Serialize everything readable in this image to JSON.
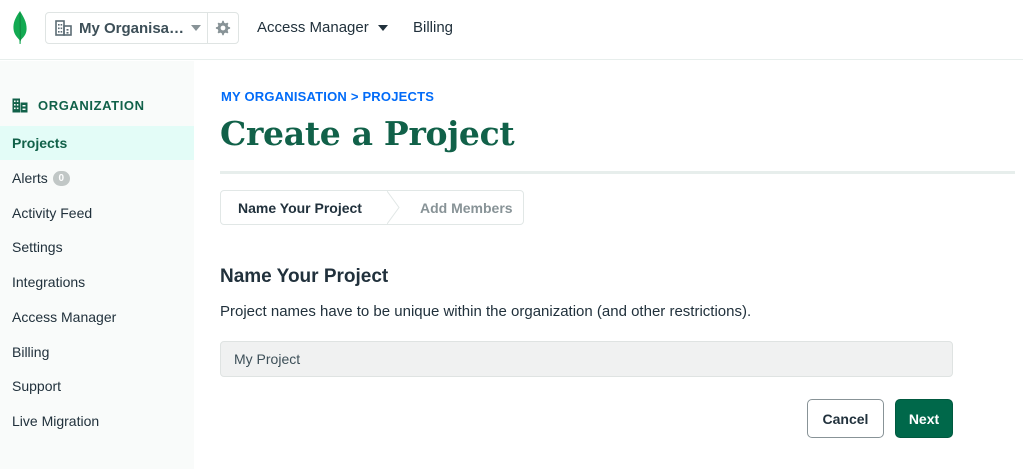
{
  "topbar": {
    "org_name": "My Organisa…",
    "nav": [
      {
        "label": "Access Manager"
      },
      {
        "label": "Billing"
      }
    ]
  },
  "sidebar": {
    "section_label": "ORGANIZATION",
    "items": [
      {
        "label": "Projects",
        "active": true
      },
      {
        "label": "Alerts",
        "badge": "0"
      },
      {
        "label": "Activity Feed"
      },
      {
        "label": "Settings"
      },
      {
        "label": "Integrations"
      },
      {
        "label": "Access Manager"
      },
      {
        "label": "Billing"
      },
      {
        "label": "Support"
      },
      {
        "label": "Live Migration"
      }
    ]
  },
  "main": {
    "breadcrumb": "MY ORGANISATION > PROJECTS",
    "title": "Create a Project",
    "steps": [
      {
        "label": "Name Your Project",
        "state": "current"
      },
      {
        "label": "Add Members",
        "state": "upcoming"
      }
    ],
    "section_title": "Name Your Project",
    "description": "Project names have to be unique within the organization (and other restrictions).",
    "project_name_input": {
      "value": "My Project"
    },
    "cancel_label": "Cancel",
    "next_label": "Next"
  },
  "colors": {
    "brand_green": "#00684a",
    "title_green": "#116149",
    "link_blue": "#016bf8",
    "active_bg": "#e3fcf7"
  }
}
